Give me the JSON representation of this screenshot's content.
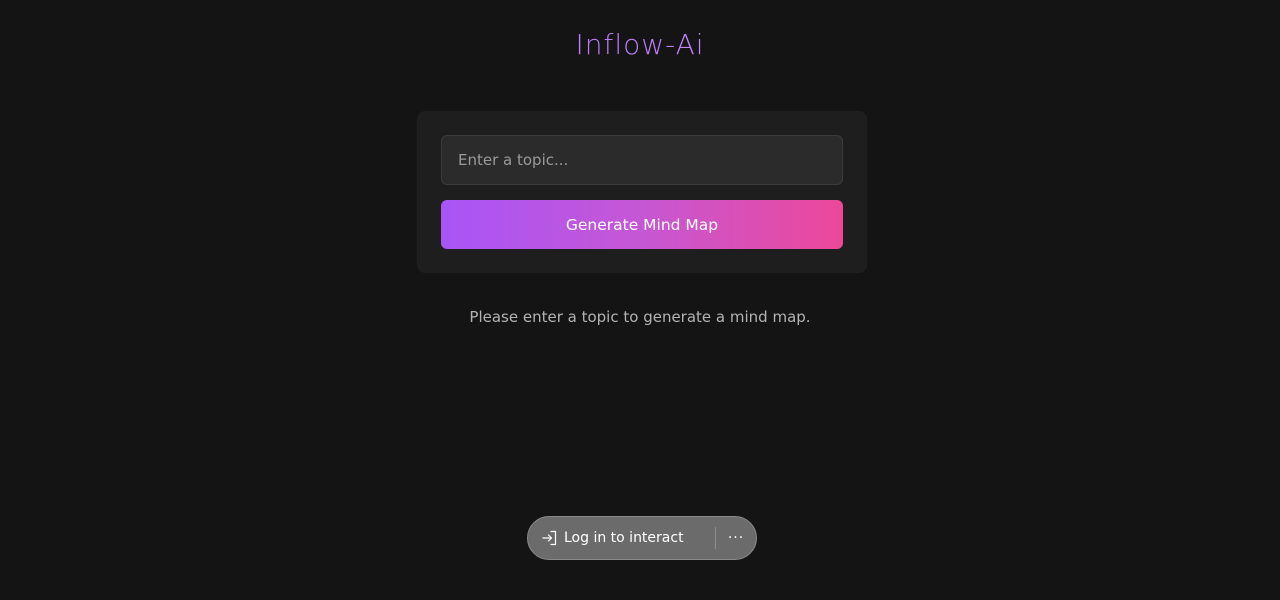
{
  "app": {
    "title": "Inflow-Ai"
  },
  "form": {
    "topic_placeholder": "Enter a topic...",
    "topic_value": "",
    "generate_label": "Generate Mind Map"
  },
  "status": {
    "message": "Please enter a topic to generate a mind map."
  },
  "overlay": {
    "login_label": "Log in to interact",
    "login_icon": "sign-in-icon",
    "more_icon": "ellipsis-icon",
    "more_symbol": "···"
  },
  "colors": {
    "background": "#141414",
    "card": "#1e1e1e",
    "accent_start": "#a855f7",
    "accent_end": "#ec4899"
  }
}
